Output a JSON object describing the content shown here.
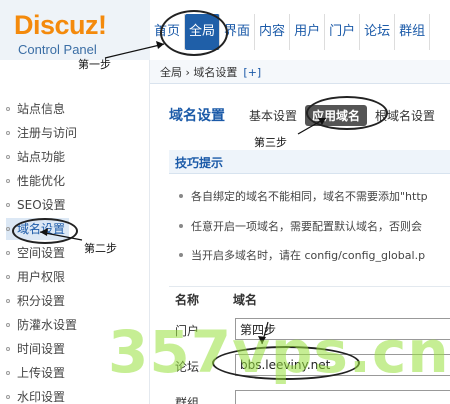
{
  "logo": {
    "brand": "Discuz",
    "bang": "!",
    "subtitle": "Control Panel"
  },
  "nav": [
    "首页",
    "全局",
    "界面",
    "内容",
    "用户",
    "门户",
    "论坛",
    "群组"
  ],
  "nav_active_index": 1,
  "breadcrumb": {
    "path": "全局 › 域名设置",
    "plus": "[+]"
  },
  "sidebar": {
    "items": [
      "站点信息",
      "注册与访问",
      "站点功能",
      "性能优化",
      "SEO设置",
      "域名设置",
      "空间设置",
      "用户权限",
      "积分设置",
      "防灌水设置",
      "时间设置",
      "上传设置",
      "水印设置"
    ],
    "active_index": 5
  },
  "main": {
    "title": "域名设置",
    "tabs": [
      "基本设置",
      "应用域名",
      "根域名设置"
    ],
    "active_tab": 1,
    "tips_title": "技巧提示",
    "tips": [
      "各自绑定的域名不能相同，域名不需要添加\"http",
      "任意开启一项域名，需要配置默认域名，否则会",
      "当开启多域名时，请在 config/config_global.p"
    ],
    "columns": {
      "name": "名称",
      "domain": "域名"
    },
    "rows": [
      {
        "label": "门户",
        "value": "第四步"
      },
      {
        "label": "论坛",
        "value": "bbs.leeviny.net"
      },
      {
        "label": "群组",
        "value": ""
      }
    ]
  },
  "annotations": {
    "step1": "第一步",
    "step2": "第二步",
    "step3": "第三步"
  },
  "watermark": "357vps.cn",
  "colors": {
    "accent": "#1f5fa8",
    "logo": "#f48a0c",
    "watermark": "#98e03c"
  }
}
